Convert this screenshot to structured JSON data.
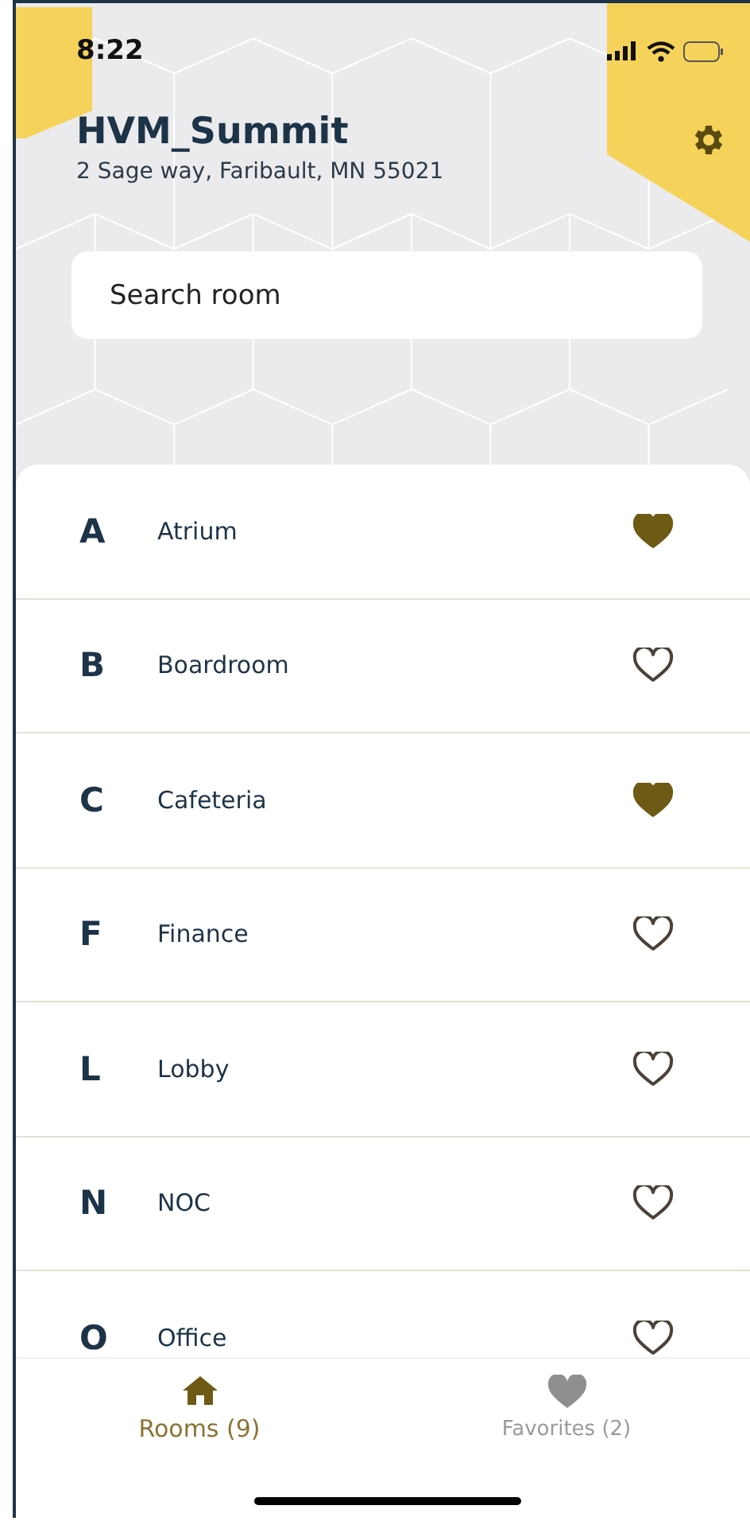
{
  "status_bar": {
    "time": "8:22"
  },
  "header": {
    "title": "HVM_Summit",
    "address": "2 Sage way, Faribault,  MN 55021"
  },
  "search": {
    "placeholder": "Search room"
  },
  "rooms": [
    {
      "letter": "A",
      "name": "Atrium",
      "favorite": true
    },
    {
      "letter": "B",
      "name": "Boardroom",
      "favorite": false
    },
    {
      "letter": "C",
      "name": "Cafeteria",
      "favorite": true
    },
    {
      "letter": "F",
      "name": "Finance",
      "favorite": false
    },
    {
      "letter": "L",
      "name": "Lobby",
      "favorite": false
    },
    {
      "letter": "N",
      "name": "NOC",
      "favorite": false
    },
    {
      "letter": "O",
      "name": "Office",
      "favorite": false
    }
  ],
  "tabs": [
    {
      "kind": "home",
      "label": "Rooms (9)",
      "selected": true
    },
    {
      "kind": "heart",
      "label": "Favorites (2)",
      "selected": false
    }
  ]
}
